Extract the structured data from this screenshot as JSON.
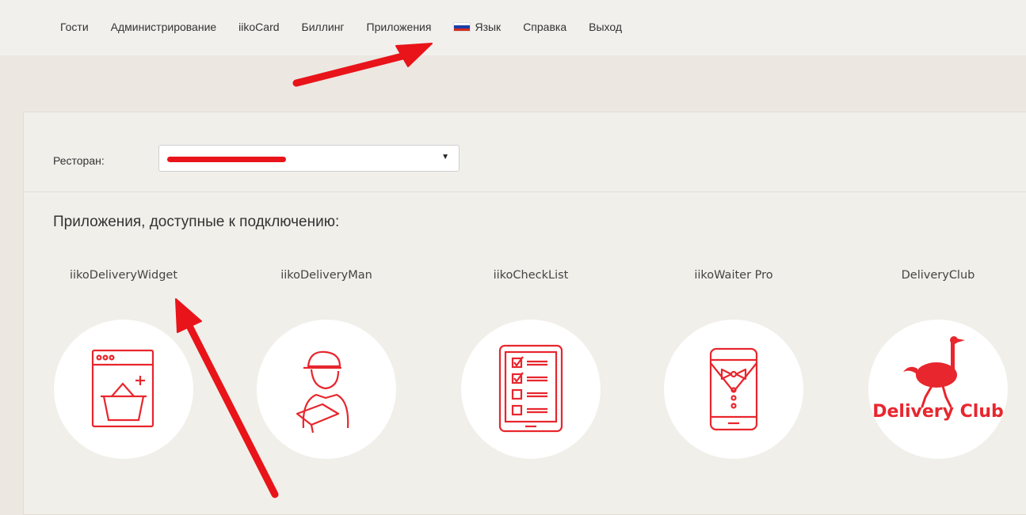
{
  "nav": {
    "items": [
      "Гости",
      "Администрирование",
      "iikoCard",
      "Биллинг",
      "Приложения"
    ],
    "language": "Язык",
    "help": "Справка",
    "logout": "Выход"
  },
  "restaurant": {
    "label": "Ресторан:",
    "selected": ""
  },
  "apps": {
    "title": "Приложения, доступные к подключению:",
    "items": [
      {
        "name": "iikoDeliveryWidget",
        "icon": "basket-window-icon"
      },
      {
        "name": "iikoDeliveryMan",
        "icon": "courier-icon"
      },
      {
        "name": "iikoCheckList",
        "icon": "checklist-icon"
      },
      {
        "name": "iikoWaiter Pro",
        "icon": "waiter-phone-icon"
      },
      {
        "name": "DeliveryClub",
        "icon": "delivery-club-logo",
        "logo_text": "Delivery Club"
      }
    ]
  },
  "colors": {
    "accent": "#e8262d",
    "annotation_arrow": "#e8141a",
    "background": "#ece7e1"
  }
}
